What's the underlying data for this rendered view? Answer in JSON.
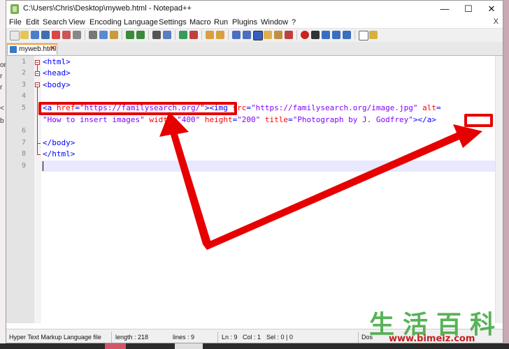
{
  "window": {
    "title": "C:\\Users\\Chris\\Desktop\\myweb.html - Notepad++",
    "minimize_glyph": "—",
    "maximize_glyph": "☐",
    "close_glyph": "✕"
  },
  "menu": {
    "items": [
      "File",
      "Edit",
      "Search",
      "View",
      "Encoding",
      "Language",
      "Settings",
      "Macro",
      "Run",
      "Plugins",
      "Window",
      "?"
    ],
    "close_glyph": "X"
  },
  "tab": {
    "label": "myweb.html",
    "close_glyph": "✕"
  },
  "editor": {
    "line_numbers": [
      "1",
      "2",
      "3",
      "4",
      "5",
      "",
      "6",
      "7",
      "8",
      "9"
    ],
    "line1": "<html>",
    "line2": "<head>",
    "line3": "<body>",
    "l5a_open": "<a ",
    "l5a_attr": "href",
    "l5a_eq": "=",
    "l5a_val": "\"https://familysearch.org/\"",
    "l5a_close": ">",
    "l5b_open": "<img ",
    "l5b_src": "src",
    "l5b_eq": "=",
    "l5b_srcval": "\"https://familysearch.org/image.jpg\"",
    "l5b_alt": " alt",
    "l5b_eq2": "=",
    "l5c_altval": "\"How to insert images\"",
    "l5c_width": " width",
    "l5c_eq": "=",
    "l5c_wval": "\"400\"",
    "l5c_height": " height",
    "l5c_eq2": "=",
    "l5c_hval": "\"200\"",
    "l5c_title": " title",
    "l5c_eq3": "=",
    "l5c_tval": "\"Photograph by J. Godfrey\"",
    "l5c_gt": ">",
    "l5c_aclose": "</a>",
    "line7": "</body>",
    "line8": "</html>"
  },
  "status": {
    "language": "Hyper Text Markup Language file",
    "length": "length : 218",
    "lines": "lines : 9",
    "ln": "Ln : 9",
    "col": "Col : 1",
    "sel": "Sel : 0 | 0",
    "eol": "Dos"
  },
  "watermark": {
    "chars": "生活百科",
    "url": "www.bimeiz.com"
  },
  "background": {
    "fragments": [
      "or",
      "r",
      "r",
      "<",
      "b"
    ]
  },
  "colors": {
    "tag": "#0000ff",
    "attribute": "#ff0000",
    "value": "#8000ff",
    "highlight": "#e60000",
    "active_line": "#e8e8ff"
  }
}
